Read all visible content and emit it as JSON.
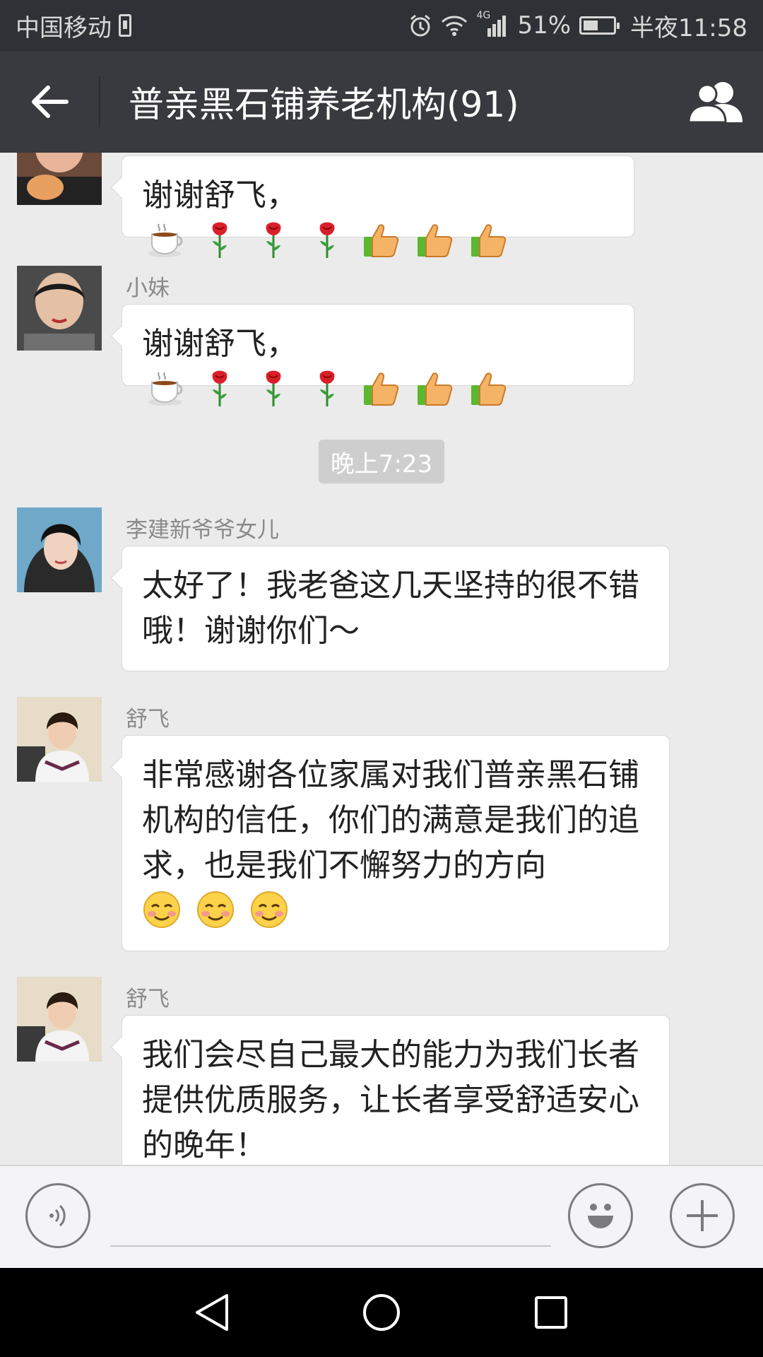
{
  "status_bar": {
    "carrier": "中国移动",
    "network": "4G",
    "battery": "51%",
    "battery_level": 0.51,
    "time": "半夜11:58"
  },
  "title_bar": {
    "title": "普亲黑石铺养老机构(91)"
  },
  "chat": {
    "messages": [
      {
        "sender": "",
        "text": "谢谢舒飞，",
        "emojis": [
          "coffee",
          "rose",
          "rose",
          "rose",
          "thumbs-up",
          "thumbs-up",
          "thumbs-up"
        ]
      },
      {
        "sender": "小妹",
        "text": "谢谢舒飞，",
        "emojis": [
          "coffee",
          "rose",
          "rose",
          "rose",
          "thumbs-up",
          "thumbs-up",
          "thumbs-up"
        ]
      },
      {
        "timestamp": "晚上7:23"
      },
      {
        "sender": "李建新爷爷女儿",
        "text": "太好了！我老爸这几天坚持的很不错哦！谢谢你们～"
      },
      {
        "sender": "舒飞",
        "text": "非常感谢各位家属对我们普亲黑石铺机构的信任，你们的满意是我们的追求，也是我们不懈努力的方向",
        "emojis": [
          "smile",
          "smile",
          "smile"
        ]
      },
      {
        "sender": "舒飞",
        "text": "我们会尽自己最大的能力为我们长者提供优质服务，让长者享受舒适安心的晚年！"
      }
    ]
  },
  "input_bar": {
    "placeholder": ""
  },
  "colors": {
    "status_bg": "#2e3135",
    "title_bg": "#393a3f",
    "chat_bg": "#ebebeb",
    "bubble_bg": "#ffffff",
    "timestamp_bg": "#cecece"
  }
}
